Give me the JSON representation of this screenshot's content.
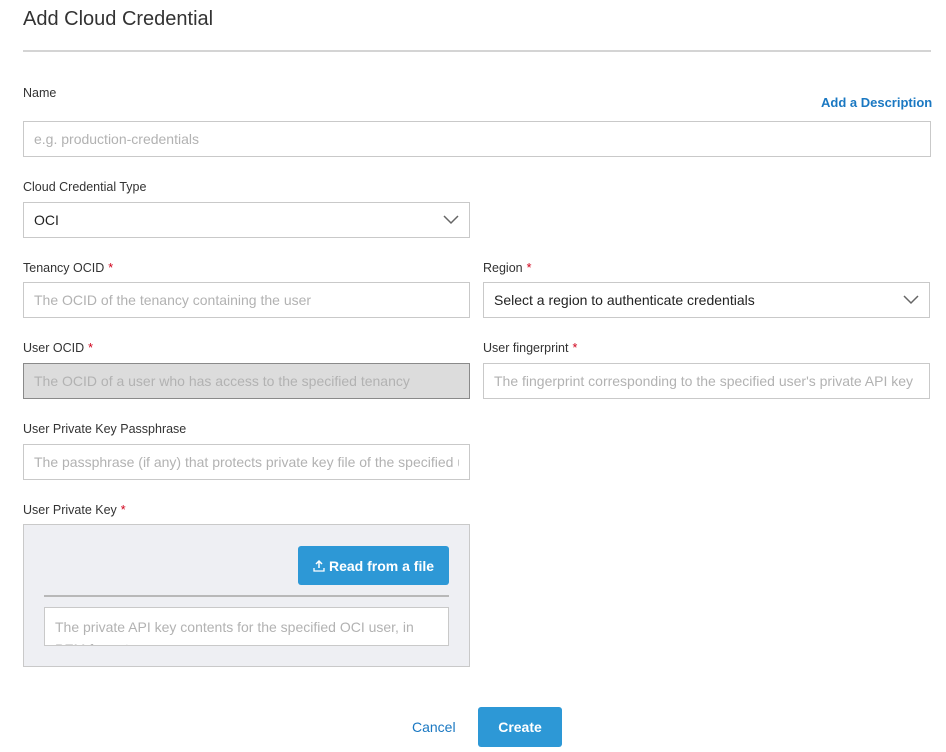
{
  "page": {
    "title": "Add Cloud Credential"
  },
  "name": {
    "label": "Name",
    "placeholder": "e.g. production-credentials",
    "add_description": "Add a Description"
  },
  "cloud_type": {
    "label": "Cloud Credential Type",
    "value": "OCI"
  },
  "tenancy": {
    "label": "Tenancy OCID",
    "required": "*",
    "placeholder": "The OCID of the tenancy containing the user"
  },
  "region": {
    "label": "Region",
    "required": "*",
    "value": "Select a region to authenticate credentials"
  },
  "user_ocid": {
    "label": "User OCID",
    "required": "*",
    "placeholder": "The OCID of a user who has access to the specified tenancy"
  },
  "fingerprint": {
    "label": "User fingerprint",
    "required": "*",
    "placeholder": "The fingerprint corresponding to the specified user's private API key"
  },
  "passphrase": {
    "label": "User Private Key Passphrase",
    "placeholder": "The passphrase (if any) that protects private key file of the specified user"
  },
  "private_key": {
    "label": "User Private Key",
    "required": "*",
    "read_file": "Read from a file",
    "placeholder": "The private API key contents for the specified OCI user, in PEM format"
  },
  "actions": {
    "cancel": "Cancel",
    "create": "Create"
  },
  "icons": {
    "chevron": "chevron-down-icon",
    "upload": "upload-icon"
  },
  "colors": {
    "accent": "#2d98d6",
    "link": "#1a78c2",
    "required": "#d0021b"
  }
}
